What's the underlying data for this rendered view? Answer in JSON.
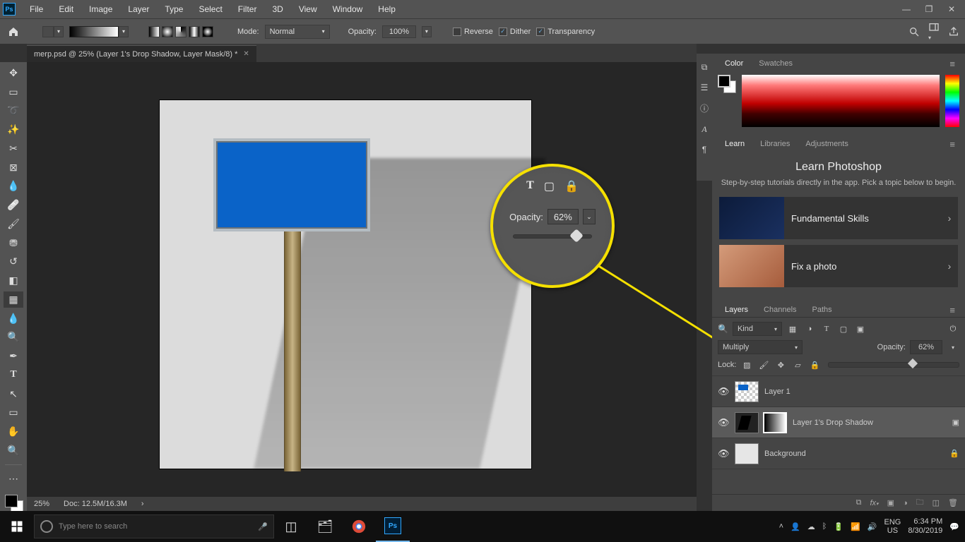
{
  "menu": {
    "items": [
      "File",
      "Edit",
      "Image",
      "Layer",
      "Type",
      "Select",
      "Filter",
      "3D",
      "View",
      "Window",
      "Help"
    ]
  },
  "options": {
    "mode_label": "Mode:",
    "mode_value": "Normal",
    "opacity_label": "Opacity:",
    "opacity_value": "100%",
    "reverse": "Reverse",
    "dither": "Dither",
    "transparency": "Transparency"
  },
  "document": {
    "tab_title": "merp.psd @ 25% (Layer 1's Drop Shadow, Layer Mask/8) *",
    "zoom": "25%",
    "docsize": "Doc: 12.5M/16.3M"
  },
  "callout": {
    "opacity_label": "Opacity:",
    "opacity_value": "62%"
  },
  "panels": {
    "color_tabs": [
      "Color",
      "Swatches"
    ],
    "learn_tabs": [
      "Learn",
      "Libraries",
      "Adjustments"
    ],
    "layers_tabs": [
      "Layers",
      "Channels",
      "Paths"
    ]
  },
  "learn": {
    "title": "Learn Photoshop",
    "sub": "Step-by-step tutorials directly in the app. Pick a topic below to begin.",
    "cards": [
      "Fundamental Skills",
      "Fix a photo"
    ]
  },
  "layers": {
    "filter_label": "Kind",
    "blend_mode": "Multiply",
    "opacity_label": "Opacity:",
    "opacity_value": "62%",
    "lock_label": "Lock:",
    "items": [
      {
        "name": "Layer 1",
        "locked": false
      },
      {
        "name": "Layer 1's Drop Shadow",
        "locked": false,
        "selected": true,
        "has_mask": true
      },
      {
        "name": "Background",
        "locked": true
      }
    ]
  },
  "taskbar": {
    "search_placeholder": "Type here to search",
    "lang": "ENG",
    "region": "US",
    "time": "6:34 PM",
    "date": "8/30/2019"
  }
}
